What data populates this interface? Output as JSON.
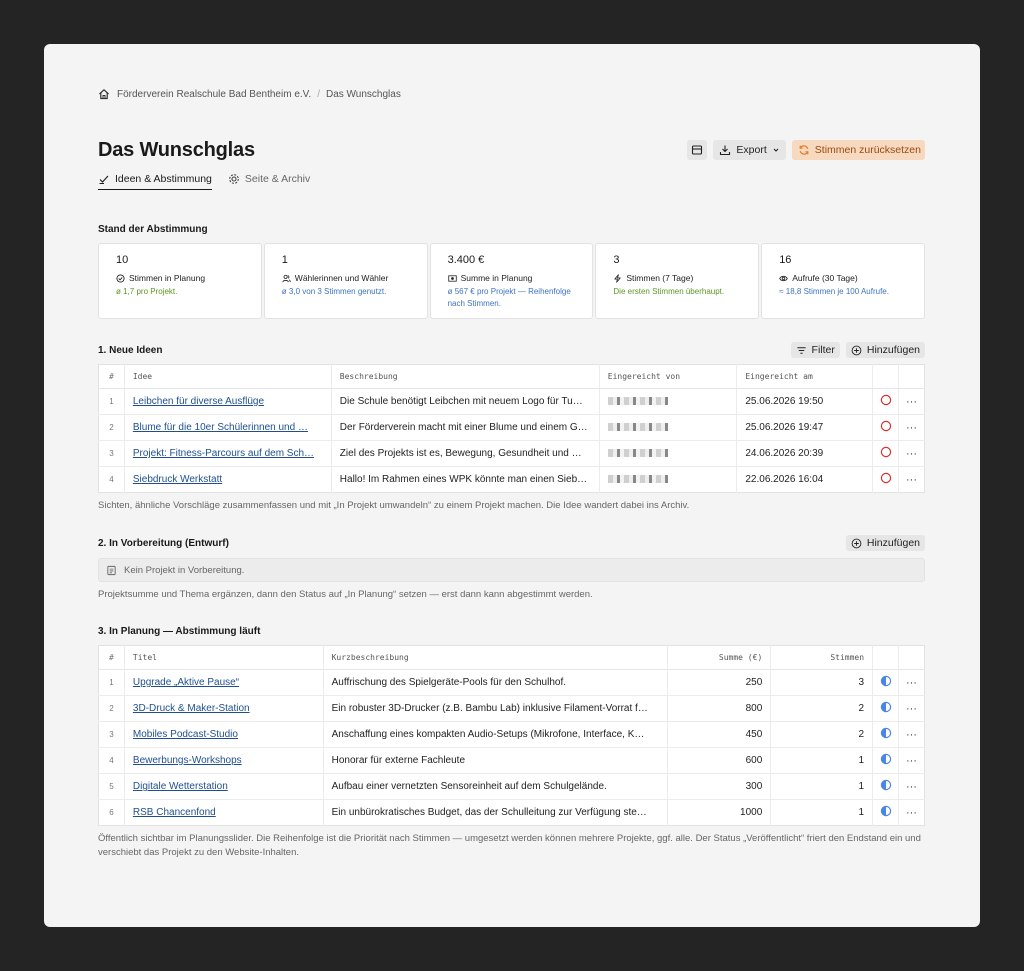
{
  "breadcrumb": {
    "org": "Förderverein Realschule Bad Bentheim e.V.",
    "separator": "/",
    "page": "Das Wunschglas"
  },
  "header": {
    "title": "Das Wunschglas",
    "export_label": "Export",
    "reset_label": "Stimmen zurücksetzen"
  },
  "tabs": [
    {
      "label": "Ideen & Abstimmung"
    },
    {
      "label": "Seite & Archiv"
    }
  ],
  "stats": {
    "title": "Stand der Abstimmung",
    "cards": [
      {
        "value": "10",
        "label": "Stimmen in Planung",
        "sub": "ø 1,7 pro Projekt.",
        "icon": "check-circle-icon"
      },
      {
        "value": "1",
        "label": "Wählerinnen und Wähler",
        "sub": "ø 3,0 von 3 Stimmen genutzt.",
        "icon": "users-icon"
      },
      {
        "value": "3.400 €",
        "label": "Summe in Planung",
        "sub": "ø 567 € pro Projekt — Reihenfolge nach Stimmen.",
        "icon": "money-icon"
      },
      {
        "value": "3",
        "label": "Stimmen (7 Tage)",
        "sub": "Die ersten Stimmen überhaupt.",
        "icon": "bolt-icon"
      },
      {
        "value": "16",
        "label": "Aufrufe (30 Tage)",
        "sub": "≈ 18,8 Stimmen je 100 Aufrufe.",
        "icon": "eye-icon"
      }
    ]
  },
  "ideas": {
    "title": "1. Neue Ideen",
    "filter_label": "Filter",
    "add_label": "Hinzufügen",
    "columns": {
      "num": "#",
      "idea": "Idee",
      "desc": "Beschreibung",
      "by": "Eingereicht von",
      "date": "Eingereicht am"
    },
    "rows": [
      {
        "num": "1",
        "idea": "Leibchen für diverse Ausflüge",
        "desc": "Die Schule benötigt Leibchen mit neuem Logo für Tu…",
        "date": "25.06.2026 19:50"
      },
      {
        "num": "2",
        "idea": "Blume für die 10er Schülerinnen und …",
        "desc": "Der Förderverein macht mit einer Blume und einem G…",
        "date": "25.06.2026 19:47"
      },
      {
        "num": "3",
        "idea": "Projekt: Fitness-Parcours auf dem Sch…",
        "desc": "Ziel des Projekts ist es, Bewegung, Gesundheit und …",
        "date": "24.06.2026 20:39"
      },
      {
        "num": "4",
        "idea": "Siebdruck Werkstatt",
        "desc": "Hallo! Im Rahmen eines WPK könnte man einen Sieb…",
        "date": "22.06.2026 16:04"
      }
    ],
    "more": "···",
    "note": "Sichten, ähnliche Vorschläge zusammenfassen und mit „In Projekt umwandeln“ zu einem Projekt machen. Die Idee wandert dabei ins Archiv."
  },
  "draft": {
    "title": "2. In Vorbereitung (Entwurf)",
    "add_label": "Hinzufügen",
    "empty": "Kein Projekt in Vorbereitung.",
    "note": "Projektsumme und Thema ergänzen, dann den Status auf „In Planung“ setzen — erst dann kann abgestimmt werden."
  },
  "planning": {
    "title": "3. In Planung — Abstimmung läuft",
    "columns": {
      "num": "#",
      "title": "Titel",
      "desc": "Kurzbeschreibung",
      "sum": "Summe (€)",
      "votes": "Stimmen"
    },
    "rows": [
      {
        "num": "1",
        "title": "Upgrade „Aktive Pause“",
        "desc": "Auffrischung des Spielgeräte-Pools für den Schulhof.",
        "sum": "250",
        "votes": "3"
      },
      {
        "num": "2",
        "title": "3D-Druck & Maker-Station",
        "desc": "Ein robuster 3D-Drucker (z.B. Bambu Lab) inklusive Filament-Vorrat f…",
        "sum": "800",
        "votes": "2"
      },
      {
        "num": "3",
        "title": "Mobiles Podcast-Studio",
        "desc": "Anschaffung eines kompakten Audio-Setups (Mikrofone, Interface, K…",
        "sum": "450",
        "votes": "2"
      },
      {
        "num": "4",
        "title": "Bewerbungs-Workshops",
        "desc": "Honorar für externe Fachleute",
        "sum": "600",
        "votes": "1"
      },
      {
        "num": "5",
        "title": "Digitale Wetterstation",
        "desc": "Aufbau einer vernetzten Sensoreinheit auf dem Schulgelände.",
        "sum": "300",
        "votes": "1"
      },
      {
        "num": "6",
        "title": "RSB Chancenfond",
        "desc": "Ein unbürokratisches Budget, das der Schulleitung zur Verfügung ste…",
        "sum": "1000",
        "votes": "1"
      }
    ],
    "more": "···",
    "note": "Öffentlich sichtbar im Planungsslider. Die Reihenfolge ist die Priorität nach Stimmen — umgesetzt werden können mehrere Projekte, ggf. alle. Der Status „Veröffentlicht“ friert den Endstand ein und verschiebt das Projekt zu den Website-Inhalten."
  },
  "colors": {
    "accent_orange": "#f7d9bf",
    "status_red": "#d9302c",
    "status_blue": "#4a86e8",
    "link": "#1f4f8f"
  }
}
